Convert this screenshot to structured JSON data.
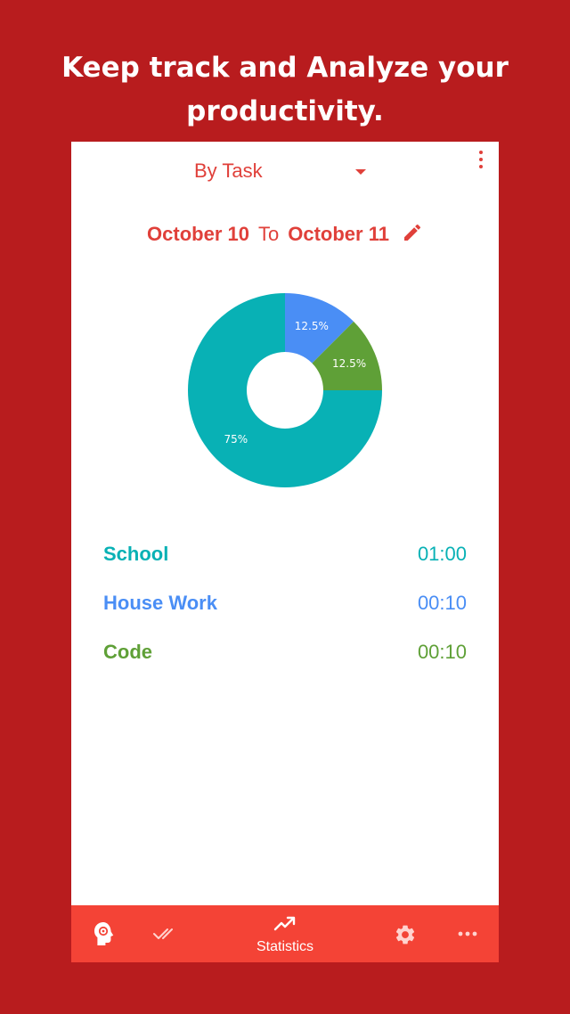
{
  "headline": {
    "line1": "Keep track and Analyze your",
    "line2": "productivity."
  },
  "filter": {
    "selected": "By Task"
  },
  "date_range": {
    "from": "October 10",
    "separator": "To",
    "to": "October 11"
  },
  "chart_data": {
    "type": "pie",
    "style": "donut",
    "slices": [
      {
        "label": "House Work",
        "value": 12.5,
        "display": "12.5%",
        "color": "#4a8ef5"
      },
      {
        "label": "Code",
        "value": 12.5,
        "display": "12.5%",
        "color": "#5fa037"
      },
      {
        "label": "School",
        "value": 75,
        "display": "75%",
        "color": "#08b1b5"
      }
    ]
  },
  "tasks": [
    {
      "name": "School",
      "time": "01:00",
      "color": "#08b1b5"
    },
    {
      "name": "House Work",
      "time": "00:10",
      "color": "#4a8ef5"
    },
    {
      "name": "Code",
      "time": "00:10",
      "color": "#5fa037"
    }
  ],
  "bottom_nav": {
    "active_label": "Statistics",
    "items": [
      {
        "icon": "brain-head-icon"
      },
      {
        "icon": "double-check-icon"
      },
      {
        "icon": "trending-up-icon",
        "label": "Statistics"
      },
      {
        "icon": "gear-icon"
      },
      {
        "icon": "more-horizontal-icon"
      }
    ]
  },
  "colors": {
    "background": "#b81c1e",
    "accent": "#e0403a",
    "nav_bar": "#f44336"
  }
}
